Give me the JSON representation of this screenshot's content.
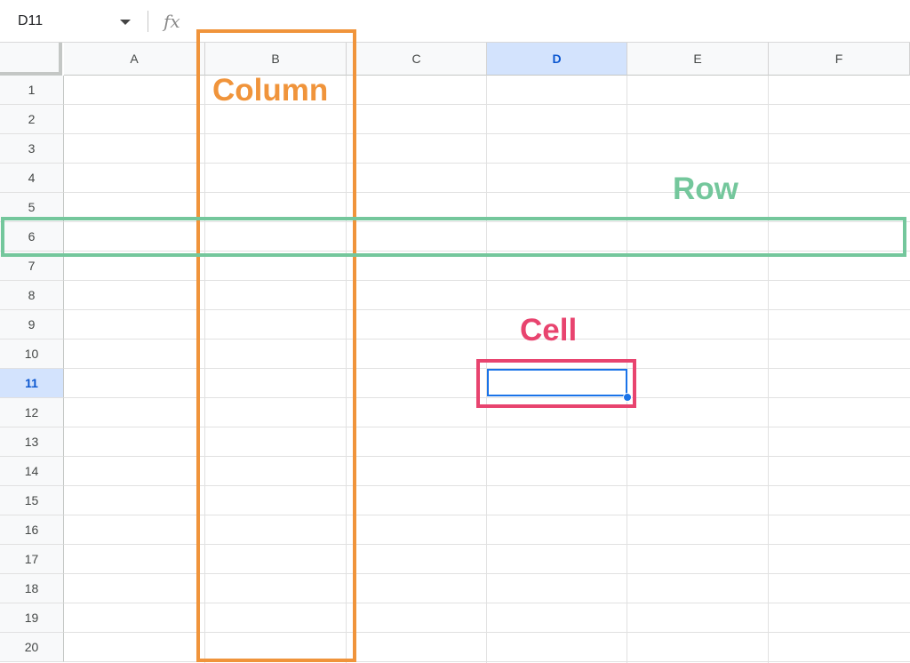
{
  "formula_bar": {
    "name_box": "D11",
    "fx_symbol": "fx",
    "formula_value": ""
  },
  "columns": [
    "A",
    "B",
    "C",
    "D",
    "E",
    "F"
  ],
  "rows": [
    "1",
    "2",
    "3",
    "4",
    "5",
    "6",
    "7",
    "8",
    "9",
    "10",
    "11",
    "12",
    "13",
    "14",
    "15",
    "16",
    "17",
    "18",
    "19",
    "20"
  ],
  "selection": {
    "column": "D",
    "row": "11"
  },
  "annotations": {
    "column_label": "Column",
    "row_label": "Row",
    "cell_label": "Cell"
  },
  "colors": {
    "column_annotation": "#f0943b",
    "row_annotation": "#74c79c",
    "cell_annotation": "#e8446f",
    "selection_accent": "#1a73e8"
  }
}
